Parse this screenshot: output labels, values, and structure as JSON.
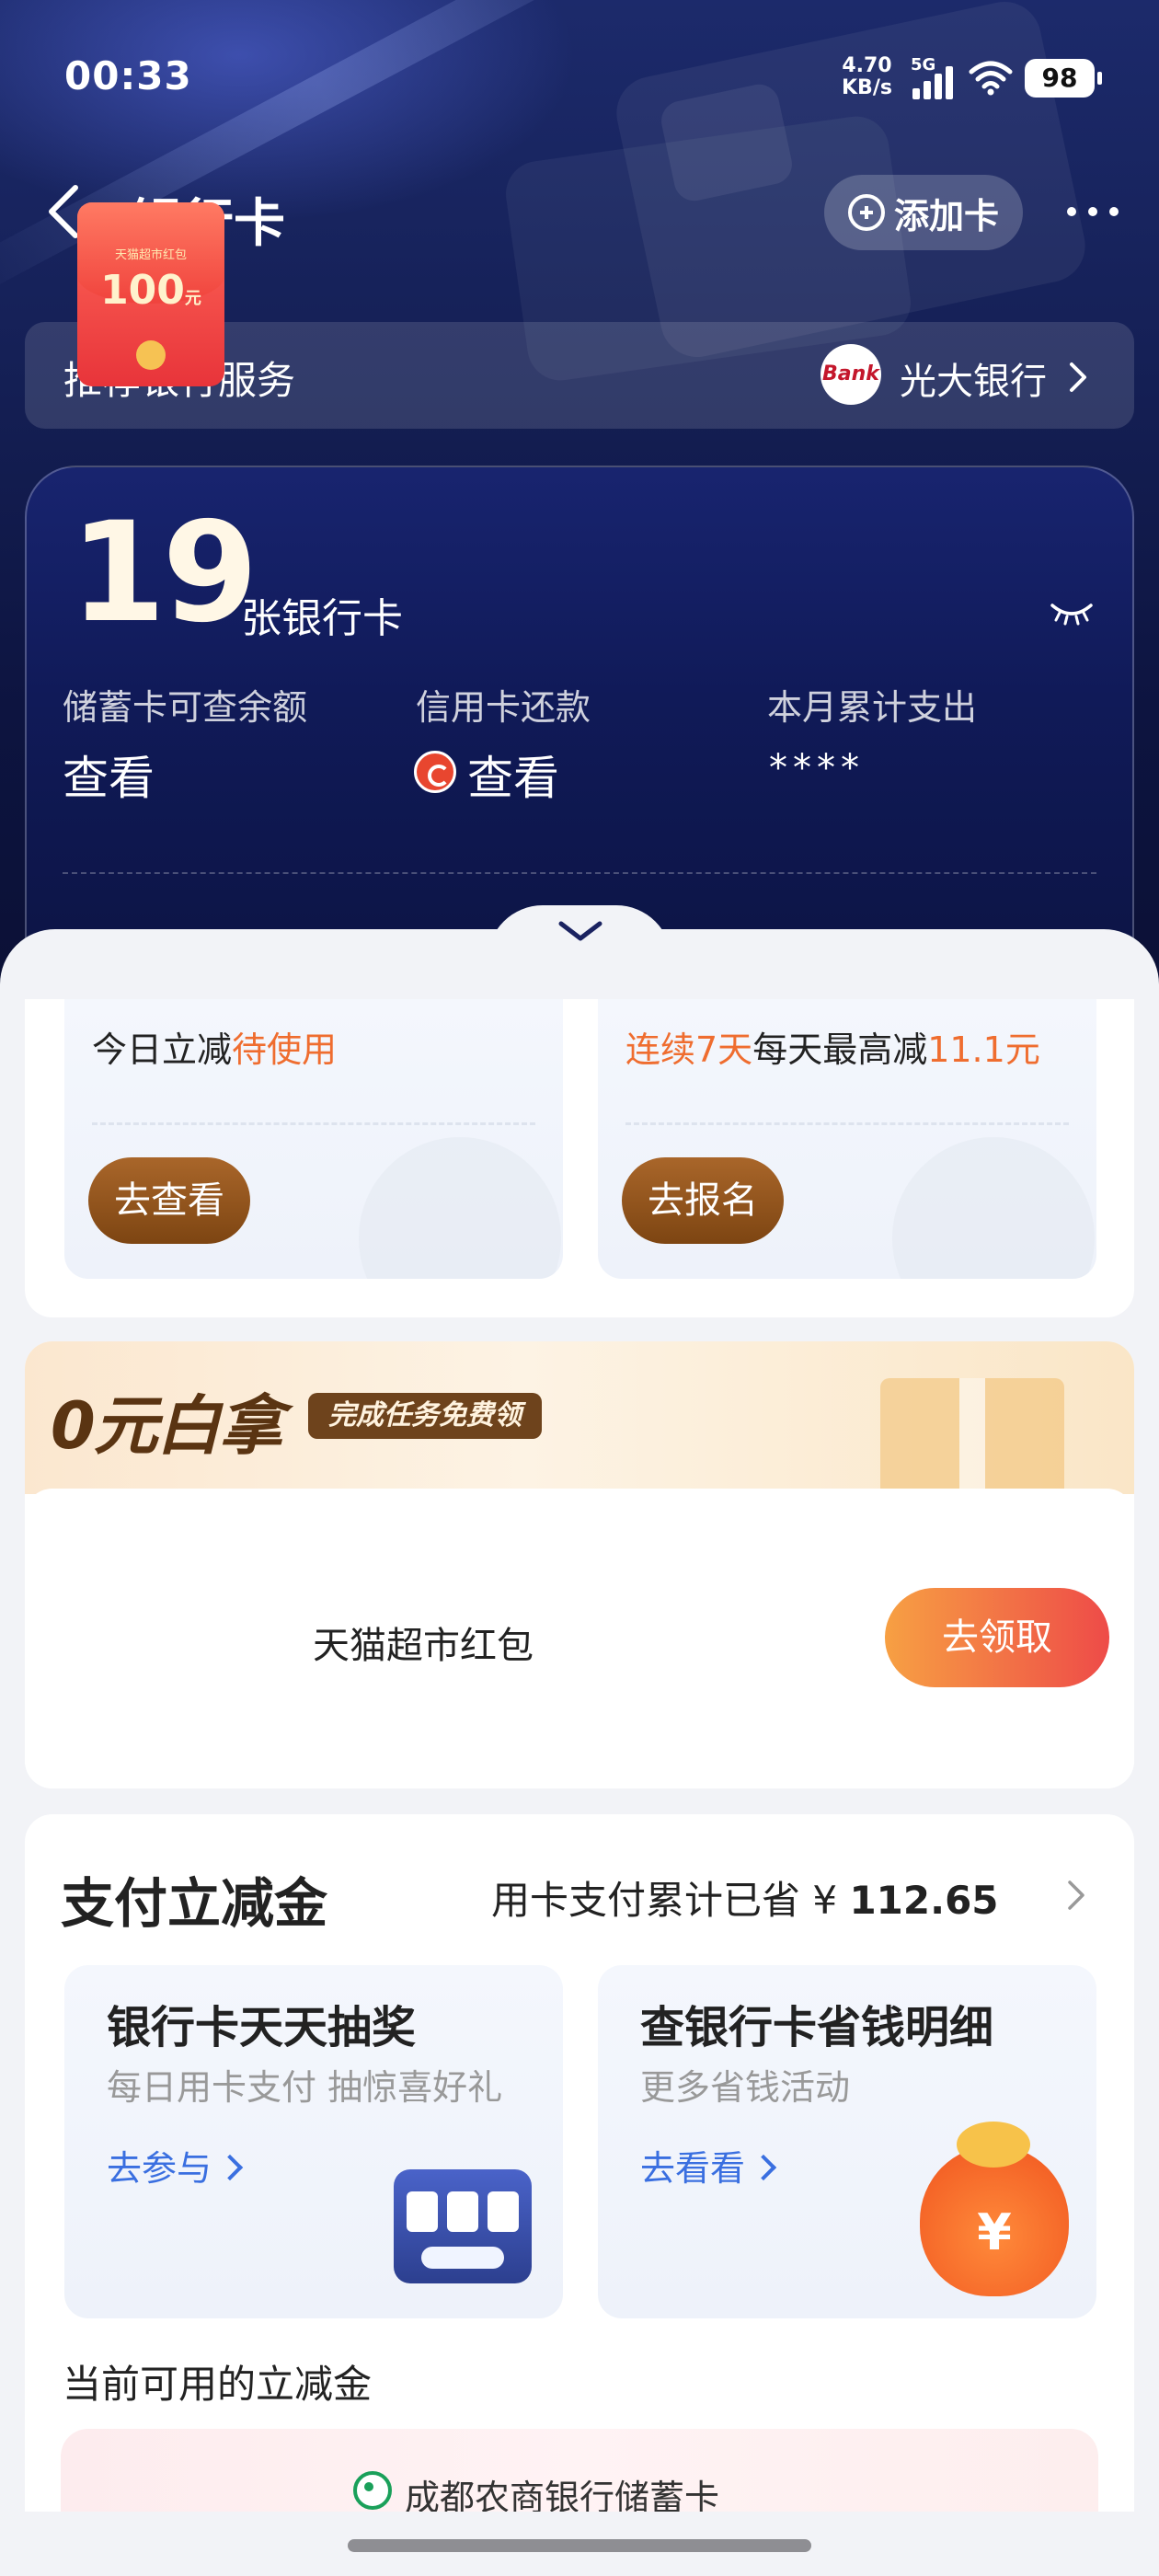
{
  "status_bar": {
    "time": "00:33",
    "net_speed_value": "4.70",
    "net_speed_unit": "KB/s",
    "signal_label": "5G",
    "battery": "98"
  },
  "nav": {
    "title": "银行卡",
    "add_card_label": "添加卡"
  },
  "recommend": {
    "title": "推荐银行服务",
    "bank_logo_text": "Bank",
    "bank_name": "光大银行"
  },
  "summary": {
    "card_count": "19",
    "card_count_unit": "张银行卡",
    "stats": [
      {
        "label": "储蓄卡可查余额",
        "value": "查看"
      },
      {
        "label": "信用卡还款",
        "value": "查看"
      },
      {
        "label": "本月累计支出",
        "value": "****"
      }
    ]
  },
  "promo": {
    "left": {
      "text_prefix": "今日立减",
      "text_highlight": "待使用",
      "button": "去查看"
    },
    "right": {
      "text_highlight1": "连续7天",
      "text_middle": "每天最高减",
      "text_highlight2": "11.1元",
      "button": "去报名"
    }
  },
  "freebie": {
    "title": "0元白拿",
    "tag": "完成任务免费领",
    "hongbao_name": "天猫超市红包",
    "hongbao_amount": "100",
    "hongbao_unit": "元",
    "item_name": "天猫超市红包",
    "claim_button": "去领取"
  },
  "pay": {
    "title": "支付立减金",
    "saved_prefix": "用卡支付累计已省 ¥ ",
    "saved_amount": "112.65",
    "cards": [
      {
        "title": "银行卡天天抽奖",
        "subtitle": "每日用卡支付 抽惊喜好礼",
        "link": "去参与"
      },
      {
        "title": "查银行卡省钱明细",
        "subtitle": "更多省钱活动",
        "link": "去看看"
      }
    ],
    "moneybag_symbol": "¥",
    "available_title": "当前可用的立减金",
    "available_bank": "成都农商银行储蓄卡"
  },
  "colors": {
    "accent_orange": "#ef6d2f",
    "link_blue": "#3a6fe0",
    "brown_button": "#7d4512",
    "banner_navy": "#152056"
  }
}
